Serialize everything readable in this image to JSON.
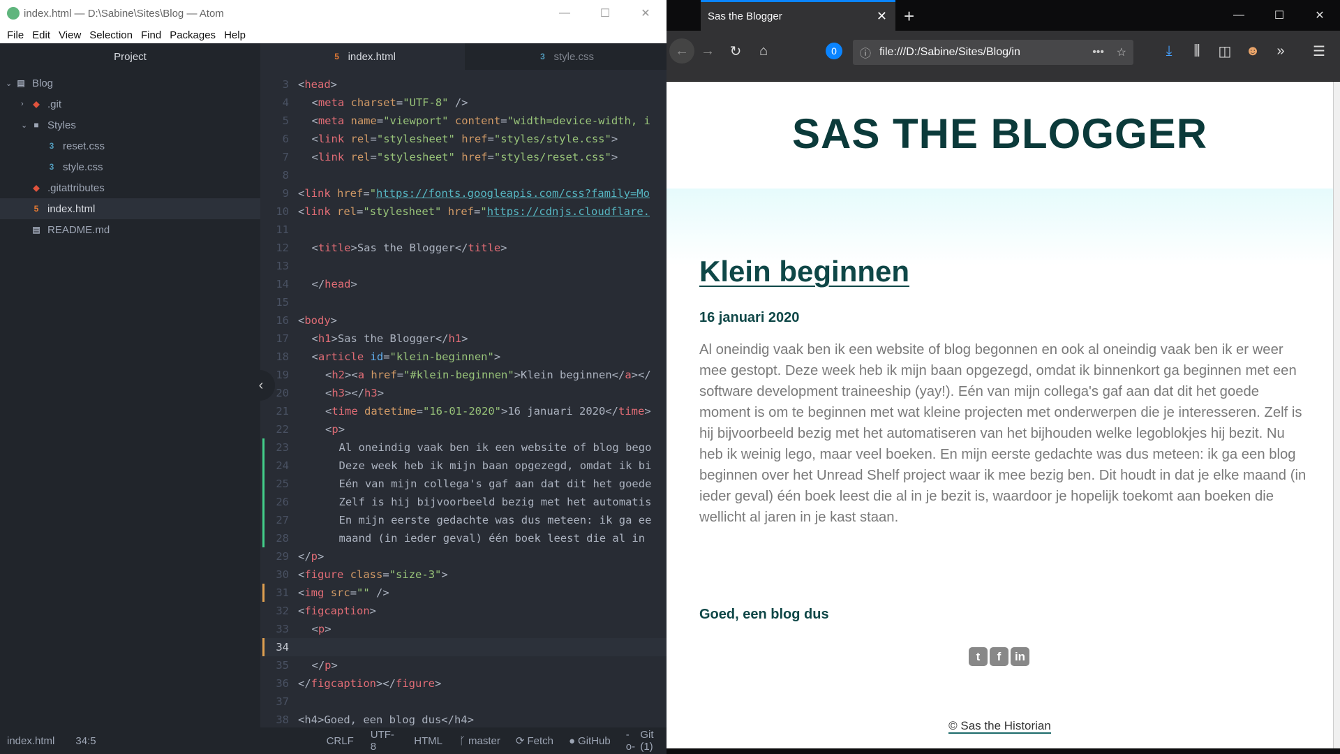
{
  "atom": {
    "window_title": "index.html — D:\\Sabine\\Sites\\Blog — Atom",
    "menu": [
      "File",
      "Edit",
      "View",
      "Selection",
      "Find",
      "Packages",
      "Help"
    ],
    "project_label": "Project",
    "tree": [
      {
        "label": "Blog",
        "icon": "book-icon",
        "depth": 0,
        "arrow": "v"
      },
      {
        "label": ".git",
        "icon": "git-icon",
        "depth": 1,
        "arrow": ">"
      },
      {
        "label": "Styles",
        "icon": "folder-icon",
        "depth": 1,
        "arrow": "v"
      },
      {
        "label": "reset.css",
        "icon": "css-icon",
        "depth": 2,
        "arrow": ""
      },
      {
        "label": "style.css",
        "icon": "css-icon",
        "depth": 2,
        "arrow": ""
      },
      {
        "label": ".gitattributes",
        "icon": "git-icon",
        "depth": 1,
        "arrow": ""
      },
      {
        "label": "index.html",
        "icon": "html-icon",
        "depth": 1,
        "arrow": "",
        "selected": true
      },
      {
        "label": "README.md",
        "icon": "book-icon",
        "depth": 1,
        "arrow": ""
      }
    ],
    "tabs": [
      {
        "label": "index.html",
        "active": true
      },
      {
        "label": "style.css",
        "active": false
      }
    ],
    "cursor_line": 34,
    "code": [
      {
        "n": 3,
        "i": 0,
        "t": [
          [
            "p",
            "<"
          ],
          [
            "tag",
            "head"
          ],
          [
            "p",
            ">"
          ]
        ]
      },
      {
        "n": 4,
        "i": 1,
        "t": [
          [
            "p",
            "<"
          ],
          [
            "tag",
            "meta"
          ],
          [
            "p",
            " "
          ],
          [
            "attr",
            "charset"
          ],
          [
            "p",
            "="
          ],
          [
            "str",
            "\"UTF-8\""
          ],
          [
            "p",
            " />"
          ]
        ]
      },
      {
        "n": 5,
        "i": 1,
        "t": [
          [
            "p",
            "<"
          ],
          [
            "tag",
            "meta"
          ],
          [
            "p",
            " "
          ],
          [
            "attr",
            "name"
          ],
          [
            "p",
            "="
          ],
          [
            "str",
            "\"viewport\""
          ],
          [
            "p",
            " "
          ],
          [
            "attr",
            "content"
          ],
          [
            "p",
            "="
          ],
          [
            "str",
            "\"width=device-width, i"
          ]
        ]
      },
      {
        "n": 6,
        "i": 1,
        "t": [
          [
            "p",
            "<"
          ],
          [
            "tag",
            "link"
          ],
          [
            "p",
            " "
          ],
          [
            "attr",
            "rel"
          ],
          [
            "p",
            "="
          ],
          [
            "str",
            "\"stylesheet\""
          ],
          [
            "p",
            " "
          ],
          [
            "attr",
            "href"
          ],
          [
            "p",
            "="
          ],
          [
            "str",
            "\"styles/style.css\""
          ],
          [
            "p",
            ">"
          ]
        ]
      },
      {
        "n": 7,
        "i": 1,
        "t": [
          [
            "p",
            "<"
          ],
          [
            "tag",
            "link"
          ],
          [
            "p",
            " "
          ],
          [
            "attr",
            "rel"
          ],
          [
            "p",
            "="
          ],
          [
            "str",
            "\"stylesheet\""
          ],
          [
            "p",
            " "
          ],
          [
            "attr",
            "href"
          ],
          [
            "p",
            "="
          ],
          [
            "str",
            "\"styles/reset.css\""
          ],
          [
            "p",
            ">"
          ]
        ]
      },
      {
        "n": 8,
        "i": 0,
        "t": []
      },
      {
        "n": 9,
        "i": 0,
        "t": [
          [
            "p",
            "<"
          ],
          [
            "tag",
            "link"
          ],
          [
            "p",
            " "
          ],
          [
            "attr",
            "href"
          ],
          [
            "p",
            "="
          ],
          [
            "str",
            "\""
          ],
          [
            "url",
            "https://fonts.googleapis.com/css?family=Mo"
          ]
        ]
      },
      {
        "n": 10,
        "i": 0,
        "t": [
          [
            "p",
            "<"
          ],
          [
            "tag",
            "link"
          ],
          [
            "p",
            " "
          ],
          [
            "attr",
            "rel"
          ],
          [
            "p",
            "="
          ],
          [
            "str",
            "\"stylesheet\""
          ],
          [
            "p",
            " "
          ],
          [
            "attr",
            "href"
          ],
          [
            "p",
            "="
          ],
          [
            "str",
            "\""
          ],
          [
            "url",
            "https://cdnjs.cloudflare."
          ]
        ]
      },
      {
        "n": 11,
        "i": 0,
        "t": []
      },
      {
        "n": 12,
        "i": 1,
        "t": [
          [
            "p",
            "<"
          ],
          [
            "tag",
            "title"
          ],
          [
            "p",
            ">Sas the Blogger</"
          ],
          [
            "tag",
            "title"
          ],
          [
            "p",
            ">"
          ]
        ]
      },
      {
        "n": 13,
        "i": 0,
        "t": []
      },
      {
        "n": 14,
        "i": 1,
        "t": [
          [
            "p",
            "</"
          ],
          [
            "tag",
            "head"
          ],
          [
            "p",
            ">"
          ]
        ]
      },
      {
        "n": 15,
        "i": 0,
        "t": []
      },
      {
        "n": 16,
        "i": 0,
        "t": [
          [
            "p",
            "<"
          ],
          [
            "tag",
            "body"
          ],
          [
            "p",
            ">"
          ]
        ]
      },
      {
        "n": 17,
        "i": 1,
        "t": [
          [
            "p",
            "<"
          ],
          [
            "tag",
            "h1"
          ],
          [
            "p",
            ">Sas the Blogger</"
          ],
          [
            "tag",
            "h1"
          ],
          [
            "p",
            ">"
          ]
        ]
      },
      {
        "n": 18,
        "i": 1,
        "t": [
          [
            "p",
            "<"
          ],
          [
            "tag",
            "article"
          ],
          [
            "p",
            " "
          ],
          [
            "id",
            "id"
          ],
          [
            "p",
            "="
          ],
          [
            "str",
            "\"klein-beginnen\""
          ],
          [
            "p",
            ">"
          ]
        ]
      },
      {
        "n": 19,
        "i": 2,
        "t": [
          [
            "p",
            "<"
          ],
          [
            "tag",
            "h2"
          ],
          [
            "p",
            "><"
          ],
          [
            "tag",
            "a"
          ],
          [
            "p",
            " "
          ],
          [
            "attr",
            "href"
          ],
          [
            "p",
            "="
          ],
          [
            "str",
            "\"#klein-beginnen\""
          ],
          [
            "p",
            ">Klein beginnen</"
          ],
          [
            "tag",
            "a"
          ],
          [
            "p",
            "></"
          ]
        ]
      },
      {
        "n": 20,
        "i": 2,
        "t": [
          [
            "p",
            "<"
          ],
          [
            "tag",
            "h3"
          ],
          [
            "p",
            "></"
          ],
          [
            "tag",
            "h3"
          ],
          [
            "p",
            ">"
          ]
        ]
      },
      {
        "n": 21,
        "i": 2,
        "t": [
          [
            "p",
            "<"
          ],
          [
            "tag",
            "time"
          ],
          [
            "p",
            " "
          ],
          [
            "attr",
            "datetime"
          ],
          [
            "p",
            "="
          ],
          [
            "str",
            "\"16-01-2020\""
          ],
          [
            "p",
            ">16 januari 2020</"
          ],
          [
            "tag",
            "time"
          ],
          [
            "p",
            ">"
          ]
        ]
      },
      {
        "n": 22,
        "i": 2,
        "t": [
          [
            "p",
            "<"
          ],
          [
            "tag",
            "p"
          ],
          [
            "p",
            ">"
          ]
        ]
      },
      {
        "n": 23,
        "i": 3,
        "t": [
          [
            "p",
            "Al oneindig vaak ben ik een website of blog bego"
          ]
        ]
      },
      {
        "n": 24,
        "i": 3,
        "t": [
          [
            "p",
            "Deze week heb ik mijn baan opgezegd, omdat ik bi"
          ]
        ]
      },
      {
        "n": 25,
        "i": 3,
        "t": [
          [
            "p",
            "Eén van mijn collega's gaf aan dat dit het goede"
          ]
        ]
      },
      {
        "n": 26,
        "i": 3,
        "t": [
          [
            "p",
            "Zelf is hij bijvoorbeeld bezig met het automatis"
          ]
        ]
      },
      {
        "n": 27,
        "i": 3,
        "t": [
          [
            "p",
            "En mijn eerste gedachte was dus meteen: ik ga ee"
          ]
        ]
      },
      {
        "n": 28,
        "i": 3,
        "t": [
          [
            "p",
            "maand (in ieder geval) één boek leest die al in"
          ]
        ]
      },
      {
        "n": 29,
        "i": 0,
        "t": [
          [
            "p",
            "</"
          ],
          [
            "tag",
            "p"
          ],
          [
            "p",
            ">"
          ]
        ]
      },
      {
        "n": 30,
        "i": 0,
        "t": [
          [
            "p",
            "<"
          ],
          [
            "tag",
            "figure"
          ],
          [
            "p",
            " "
          ],
          [
            "attr",
            "class"
          ],
          [
            "p",
            "="
          ],
          [
            "str",
            "\"size-3\""
          ],
          [
            "p",
            ">"
          ]
        ]
      },
      {
        "n": 31,
        "i": 0,
        "t": [
          [
            "p",
            "<"
          ],
          [
            "tag",
            "img"
          ],
          [
            "p",
            " "
          ],
          [
            "attr",
            "src"
          ],
          [
            "p",
            "="
          ],
          [
            "str",
            "\"\""
          ],
          [
            "p",
            " />"
          ]
        ]
      },
      {
        "n": 32,
        "i": 0,
        "t": [
          [
            "p",
            "<"
          ],
          [
            "tag",
            "figcaption"
          ],
          [
            "p",
            ">"
          ]
        ]
      },
      {
        "n": 33,
        "i": 1,
        "t": [
          [
            "p",
            "<"
          ],
          [
            "tag",
            "p"
          ],
          [
            "p",
            ">"
          ]
        ]
      },
      {
        "n": 34,
        "i": 0,
        "t": []
      },
      {
        "n": 35,
        "i": 1,
        "t": [
          [
            "p",
            "</"
          ],
          [
            "tag",
            "p"
          ],
          [
            "p",
            ">"
          ]
        ]
      },
      {
        "n": 36,
        "i": 0,
        "t": [
          [
            "p",
            "</"
          ],
          [
            "tag",
            "figcaption"
          ],
          [
            "p",
            "></"
          ],
          [
            "tag",
            "figure"
          ],
          [
            "p",
            ">"
          ]
        ]
      },
      {
        "n": 37,
        "i": 0,
        "t": []
      },
      {
        "n": 38,
        "i": 0,
        "t": [
          [
            "p",
            "<h4>Goed, een blog dus</h4>"
          ]
        ]
      }
    ],
    "status": {
      "file": "index.html",
      "position": "34:5",
      "line_ending": "CRLF",
      "encoding": "UTF-8",
      "grammar": "HTML",
      "branch": "master",
      "fetch": "Fetch",
      "github": "GitHub",
      "git": "Git (1)"
    }
  },
  "firefox": {
    "tab_title": "Sas the Blogger",
    "url": "file:///D:/Sabine/Sites/Blog/in",
    "page": {
      "site_title": "SAS THE BLOGGER",
      "article_title": "Klein beginnen",
      "date": "16 januari 2020",
      "paragraph": "Al oneindig vaak ben ik een website of blog begonnen en ook al oneindig vaak ben ik er weer mee gestopt. Deze week heb ik mijn baan opgezegd, omdat ik binnenkort ga beginnen met een software development traineeship (yay!). Eén van mijn collega's gaf aan dat dit het goede moment is om te beginnen met wat kleine projecten met onderwerpen die je interesseren. Zelf is hij bijvoorbeeld bezig met het automatiseren van het bijhouden welke legoblokjes hij bezit. Nu heb ik weinig lego, maar veel boeken. En mijn eerste gedachte was dus meteen: ik ga een blog beginnen over het Unread Shelf project waar ik mee bezig ben. Dit houdt in dat je elke maand (in ieder geval) één boek leest die al in je bezit is, waardoor je hopelijk toekomt aan boeken die wellicht al jaren in je kast staan.",
      "subheading": "Goed, een blog dus",
      "social": [
        "twitter",
        "facebook",
        "linkedin"
      ],
      "footer": "© Sas the Historian"
    }
  }
}
